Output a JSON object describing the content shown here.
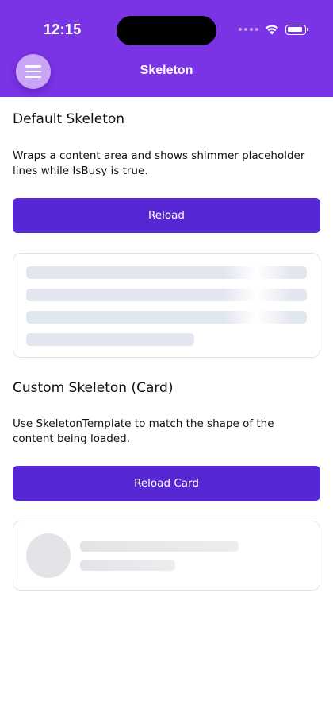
{
  "status_bar": {
    "time": "12:15",
    "icons": [
      "signal-dots-icon",
      "wifi-icon",
      "battery-icon"
    ]
  },
  "header": {
    "title": "Skeleton",
    "menu_icon": "hamburger-icon",
    "color": "#7b33e6"
  },
  "sections": [
    {
      "heading": "Default Skeleton",
      "description": "Wraps a content area and shows shimmer placeholder lines while IsBusy is true.",
      "button_label": "Reload",
      "placeholder_lines": 4
    },
    {
      "heading": "Custom Skeleton (Card)",
      "description": "Use SkeletonTemplate to match the shape of the content being loaded.",
      "button_label": "Reload Card"
    }
  ],
  "colors": {
    "button": "#5528d4",
    "placeholder": "#e2e6ef"
  }
}
